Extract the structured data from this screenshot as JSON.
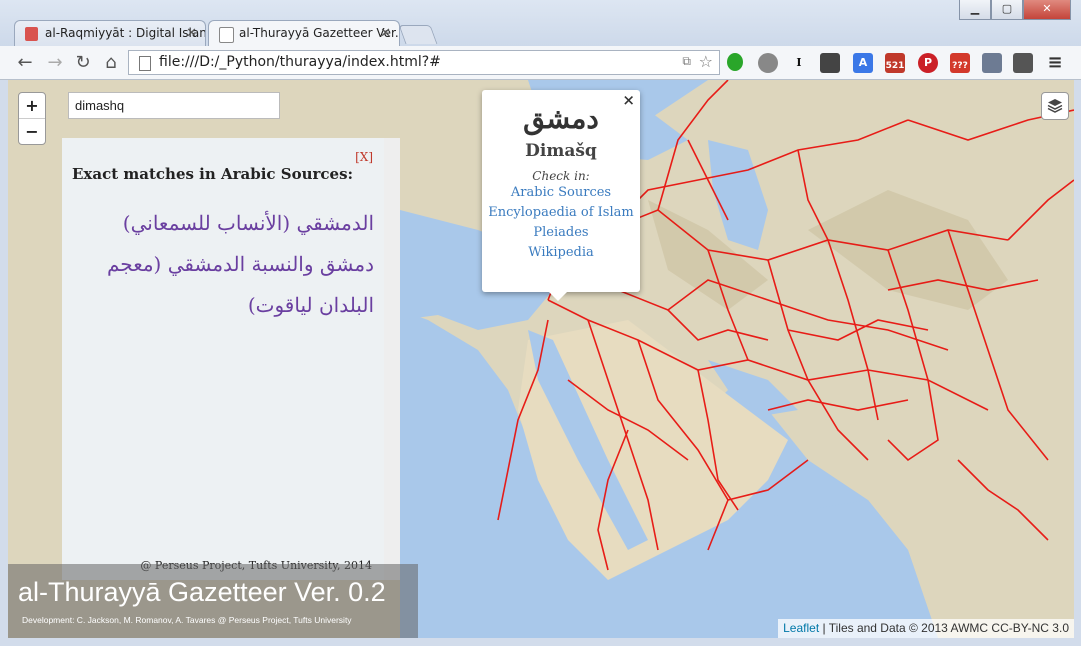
{
  "browser": {
    "tabs": [
      {
        "label": "al-Raqmiyyāt : Digital Islan",
        "icon_color": "#d9534f",
        "active": false
      },
      {
        "label": "al-Thurayyā Gazetteer Ver.",
        "icon_color": "#ffffff",
        "active": true
      }
    ],
    "url": "file:///D:/_Python/thurayya/index.html?#",
    "extensions": [
      "green-leaf-icon",
      "privacy-icon",
      "I",
      "pocket-icon",
      "translate-icon",
      "521",
      "pinterest-icon",
      "???",
      "page-icon",
      "evernote-icon"
    ]
  },
  "map": {
    "zoom_in": "+",
    "zoom_out": "−",
    "search_value": "dimashq",
    "results": {
      "close_label": "[X]",
      "heading": "Exact matches in Arabic Sources:",
      "lines": [
        "الدمشقي (الأنساب للسمعاني)",
        "دمشق والنسبة الدمشقي (معجم",
        "البلدان لياقوت)"
      ],
      "credit": "@ Perseus Project, Tufts University, 2014"
    },
    "popup": {
      "arabic_name": "دمشق",
      "transliteration": "Dimašq",
      "check_in": "Check in:",
      "links": [
        "Arabic Sources",
        "Encylopaedia of Islam",
        "Pleiades",
        "Wikipedia"
      ]
    },
    "banner": {
      "title": "al-Thurayyā Gazetteer Ver. 0.2",
      "subtitle": "Development: C. Jackson, M. Romanov, A. Tavares @ Perseus Project, Tufts University"
    },
    "attribution": {
      "leaflet": "Leaflet",
      "text": " | Tiles and Data © 2013 AWMC CC-BY-NC 3.0"
    },
    "colors": {
      "routes": "#e8130f",
      "sea": "#a9c8ea",
      "land": "#ddd6bd"
    }
  }
}
